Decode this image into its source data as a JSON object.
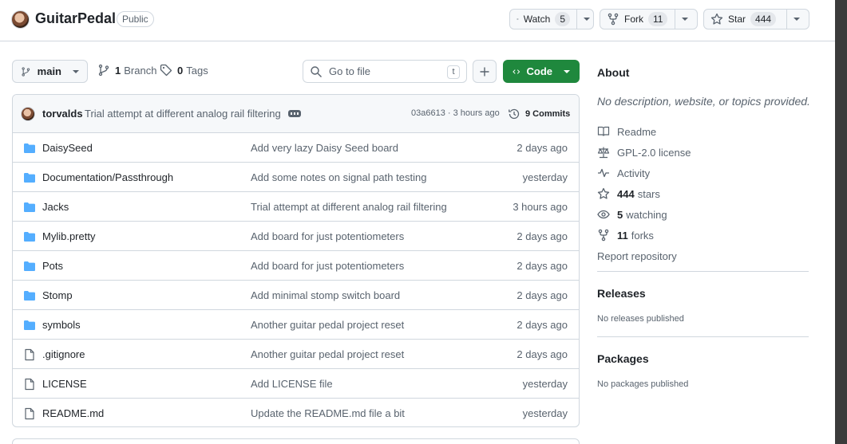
{
  "repo": {
    "name": "GuitarPedal",
    "visibility": "Public"
  },
  "actions": {
    "watch_label": "Watch",
    "watch_count": "5",
    "fork_label": "Fork",
    "fork_count": "11",
    "star_label": "Star",
    "star_count": "444"
  },
  "branch_bar": {
    "branch": "main",
    "branches_count": "1",
    "branches_label": "Branch",
    "tags_count": "0",
    "tags_label": "Tags",
    "go_to_file_placeholder": "Go to file",
    "go_to_file_key": "t",
    "code_label": "Code"
  },
  "latest_commit": {
    "author": "torvalds",
    "message": "Trial attempt at different analog rail filtering",
    "hash_time": "03a6613 · 3 hours ago",
    "commits_label": "9 Commits"
  },
  "files": [
    {
      "name": "DaisySeed",
      "type": "folder",
      "message": "Add very lazy Daisy Seed board",
      "date": "2 days ago"
    },
    {
      "name": "Documentation/Passthrough",
      "type": "folder",
      "message": "Add some notes on signal path testing",
      "date": "yesterday"
    },
    {
      "name": "Jacks",
      "type": "folder",
      "message": "Trial attempt at different analog rail filtering",
      "date": "3 hours ago"
    },
    {
      "name": "Mylib.pretty",
      "type": "folder",
      "message": "Add board for just potentiometers",
      "date": "2 days ago"
    },
    {
      "name": "Pots",
      "type": "folder",
      "message": "Add board for just potentiometers",
      "date": "2 days ago"
    },
    {
      "name": "Stomp",
      "type": "folder",
      "message": "Add minimal stomp switch board",
      "date": "2 days ago"
    },
    {
      "name": "symbols",
      "type": "folder",
      "message": "Another guitar pedal project reset",
      "date": "2 days ago"
    },
    {
      "name": ".gitignore",
      "type": "file",
      "message": "Another guitar pedal project reset",
      "date": "2 days ago"
    },
    {
      "name": "LICENSE",
      "type": "file",
      "message": "Add LICENSE file",
      "date": "yesterday"
    },
    {
      "name": "README.md",
      "type": "file",
      "message": "Update the README.md file a bit",
      "date": "yesterday"
    }
  ],
  "about": {
    "title": "About",
    "description": "No description, website, or topics provided.",
    "readme": "Readme",
    "license": "GPL-2.0 license",
    "activity": "Activity",
    "stars_count": "444",
    "stars_label": "stars",
    "watching_count": "5",
    "watching_label": "watching",
    "forks_count": "11",
    "forks_label": "forks",
    "report": "Report repository"
  },
  "releases": {
    "title": "Releases",
    "subtitle": "No releases published"
  },
  "packages": {
    "title": "Packages",
    "subtitle": "No packages published"
  },
  "colors": {
    "accent_green": "#1f883d",
    "folder_blue": "#54aeff",
    "border": "#d0d7de"
  }
}
